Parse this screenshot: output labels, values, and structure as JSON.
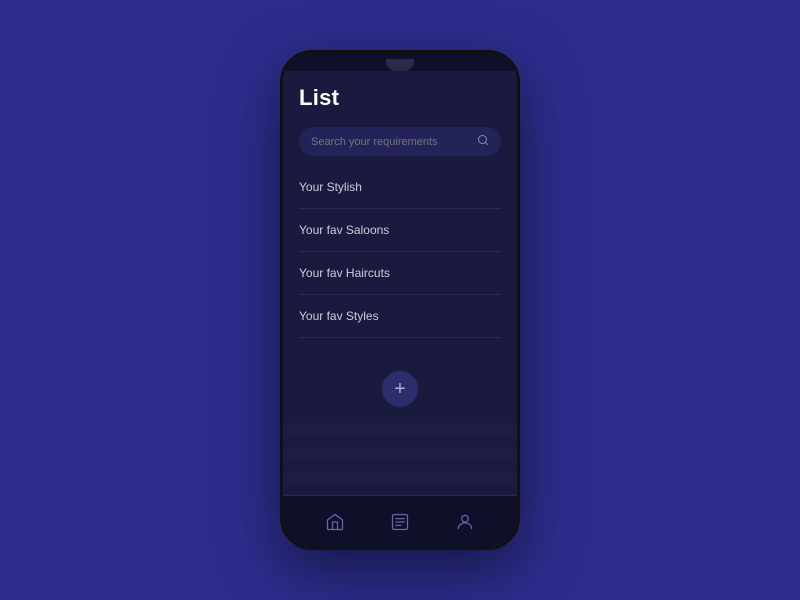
{
  "page": {
    "background_color": "#2d2d8e",
    "title": "List",
    "search": {
      "placeholder": "Search your requirements"
    },
    "list_items": [
      {
        "id": 1,
        "label": "Your Stylish"
      },
      {
        "id": 2,
        "label": "Your fav Saloons"
      },
      {
        "id": 3,
        "label": "Your fav Haircuts"
      },
      {
        "id": 4,
        "label": "Your fav Styles"
      }
    ],
    "add_button_label": "+",
    "nav": {
      "home_label": "home",
      "list_label": "list",
      "profile_label": "profile"
    }
  }
}
